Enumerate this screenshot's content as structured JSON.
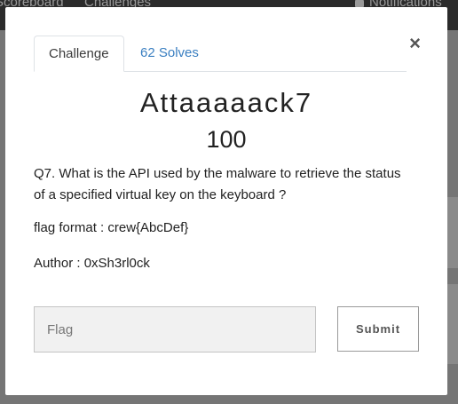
{
  "nav": {
    "scoreboard": "Scoreboard",
    "challenges": "Challenges",
    "notifications": "Notifications"
  },
  "modal": {
    "tabs": [
      {
        "label": "Challenge",
        "active": true
      },
      {
        "label": "62 Solves",
        "active": false
      }
    ],
    "close_label": "×",
    "title": "Attaaaaack7",
    "points": "100",
    "description": "Q7. What is the API used by the malware to retrieve the status of a specified virtual key on the keyboard ?",
    "flag_format": "flag format : crew{AbcDef}",
    "author": "Author : 0xSh3rl0ck",
    "flag_input": {
      "placeholder": "Flag",
      "value": ""
    },
    "submit_label": "Submit"
  },
  "colors": {
    "link": "#3a7fc1",
    "overlay": "#6f6f6f",
    "navbar": "#2b2b2b"
  }
}
